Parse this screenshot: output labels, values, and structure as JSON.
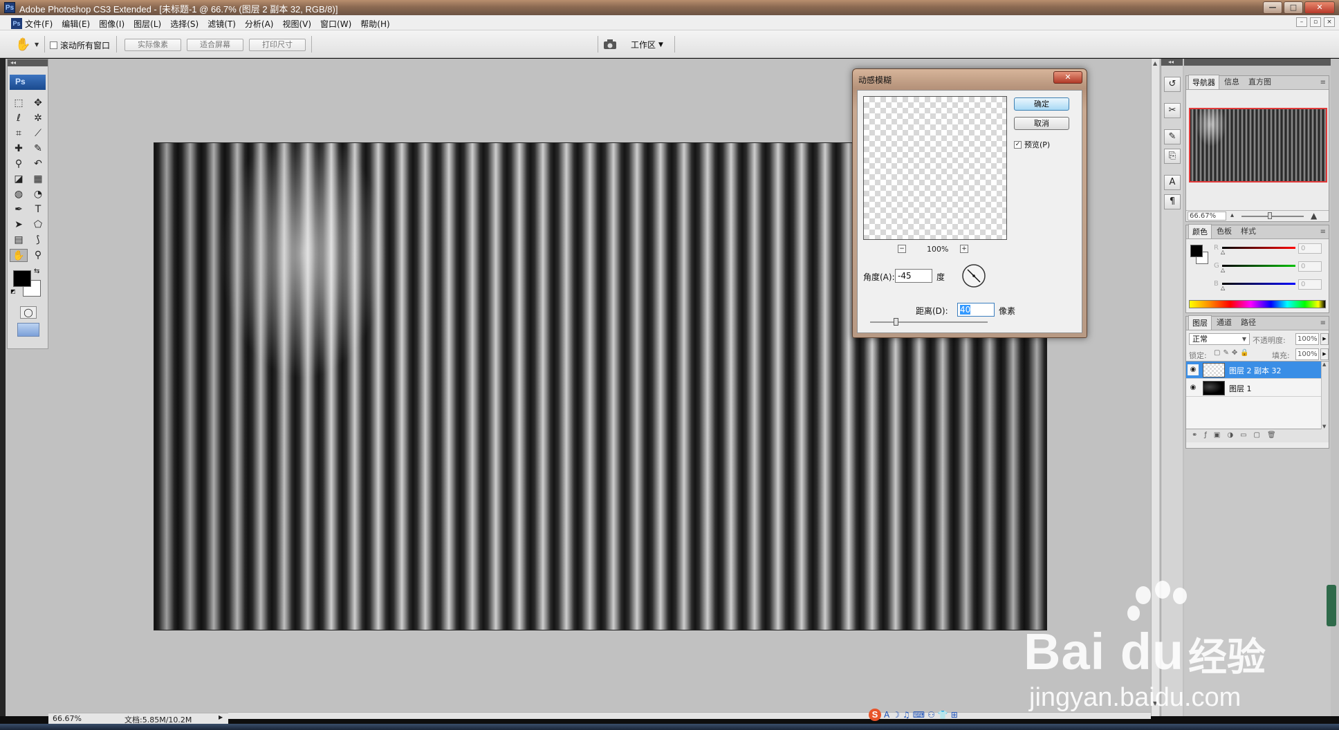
{
  "window": {
    "app_icon": "Ps",
    "title": "Adobe Photoshop CS3 Extended - [未标题-1 @ 66.7% (图层 2 副本 32, RGB/8)]",
    "controls": [
      "—",
      "□",
      "✕"
    ]
  },
  "menubar": {
    "icon": "Ps",
    "items": [
      "文件(F)",
      "编辑(E)",
      "图像(I)",
      "图层(L)",
      "选择(S)",
      "滤镜(T)",
      "分析(A)",
      "视图(V)",
      "窗口(W)",
      "帮助(H)"
    ],
    "doc_controls": [
      "–",
      "▫",
      "×"
    ]
  },
  "options_bar": {
    "tool_icon": "hand-icon",
    "scroll_all_label": "滚动所有窗口",
    "scroll_all_checked": false,
    "buttons": [
      "实际像素",
      "适合屏幕",
      "打印尺寸"
    ],
    "workspace_label": "工作区"
  },
  "toolbox": {
    "logo": "Ps",
    "tools": [
      {
        "name": "marquee-icon",
        "glyph": "⬚"
      },
      {
        "name": "move-icon",
        "glyph": "✥"
      },
      {
        "name": "lasso-icon",
        "glyph": "ℓ"
      },
      {
        "name": "magic-wand-icon",
        "glyph": "✲"
      },
      {
        "name": "crop-icon",
        "glyph": "⌗"
      },
      {
        "name": "slice-icon",
        "glyph": "⟋"
      },
      {
        "name": "healing-brush-icon",
        "glyph": "✚"
      },
      {
        "name": "brush-icon",
        "glyph": "✎"
      },
      {
        "name": "clone-stamp-icon",
        "glyph": "⚲"
      },
      {
        "name": "history-brush-icon",
        "glyph": "↶"
      },
      {
        "name": "eraser-icon",
        "glyph": "◪"
      },
      {
        "name": "gradient-icon",
        "glyph": "▦"
      },
      {
        "name": "blur-icon",
        "glyph": "◍"
      },
      {
        "name": "dodge-icon",
        "glyph": "◔"
      },
      {
        "name": "pen-icon",
        "glyph": "✒"
      },
      {
        "name": "type-icon",
        "glyph": "T"
      },
      {
        "name": "path-select-icon",
        "glyph": "➤"
      },
      {
        "name": "shape-icon",
        "glyph": "⬠"
      },
      {
        "name": "notes-icon",
        "glyph": "▤"
      },
      {
        "name": "eyedropper-icon",
        "glyph": "⟆"
      },
      {
        "name": "hand-icon",
        "glyph": "✋"
      },
      {
        "name": "zoom-icon",
        "glyph": "⚲"
      }
    ],
    "quick_mask_glyph": "◯"
  },
  "dock": {
    "icons": [
      {
        "name": "history-icon",
        "glyph": "↺"
      },
      {
        "name": "tools-preset-icon",
        "glyph": "✂"
      },
      {
        "name": "brushes-icon",
        "glyph": "✎"
      },
      {
        "name": "clone-source-icon",
        "glyph": "⎘"
      },
      {
        "name": "character-icon",
        "glyph": "A"
      },
      {
        "name": "paragraph-icon",
        "glyph": "¶"
      }
    ]
  },
  "navigator_panel": {
    "tabs": [
      "导航器",
      "信息",
      "直方图"
    ],
    "zoom": "66.67%",
    "zoom_level_fraction": 0.45
  },
  "color_panel": {
    "tabs": [
      "颜色",
      "色板",
      "样式"
    ],
    "channels": [
      {
        "label": "R",
        "value": "0",
        "color": "#ff0000"
      },
      {
        "label": "G",
        "value": "0",
        "color": "#00c000"
      },
      {
        "label": "B",
        "value": "0",
        "color": "#0000ff"
      }
    ],
    "foreground": "#000000",
    "background": "#ffffff"
  },
  "layers_panel": {
    "tabs": [
      "图层",
      "通道",
      "路径"
    ],
    "blend_mode": "正常",
    "opacity_label": "不透明度:",
    "opacity_value": "100%",
    "lock_label": "锁定:",
    "fill_label": "填充:",
    "fill_value": "100%",
    "layers": [
      {
        "name": "图层 2 副本 32",
        "selected": true,
        "thumb": "transparent"
      },
      {
        "name": "图层 1",
        "selected": false,
        "thumb": "dark"
      }
    ]
  },
  "status": {
    "zoom": "66.67%",
    "doc": "文档:5.85M/10.2M"
  },
  "dialog": {
    "title": "动感模糊",
    "close_label": "✕",
    "ok_label": "确定",
    "cancel_label": "取消",
    "preview_label": "预览(P)",
    "preview_checked": true,
    "zoom_out": "−",
    "zoom_in": "+",
    "zoom": "100%",
    "angle_label": "角度(A):",
    "angle_value": "-45",
    "angle_unit": "度",
    "distance_label": "距离(D):",
    "distance_value": "40",
    "distance_unit": "像素",
    "distance_slider_fraction": 0.22
  },
  "watermark": {
    "logo": "Bai   du",
    "cn": "经验",
    "url": "jingyan.baidu.com"
  },
  "ime": {
    "logo": "S",
    "items": [
      "A",
      "☽",
      "♫",
      "⌨",
      "⚇",
      "👕",
      "⊞"
    ]
  },
  "colors": {
    "accent_selected": "#3a8ee6",
    "navigator_frame": "#e23a3a"
  }
}
